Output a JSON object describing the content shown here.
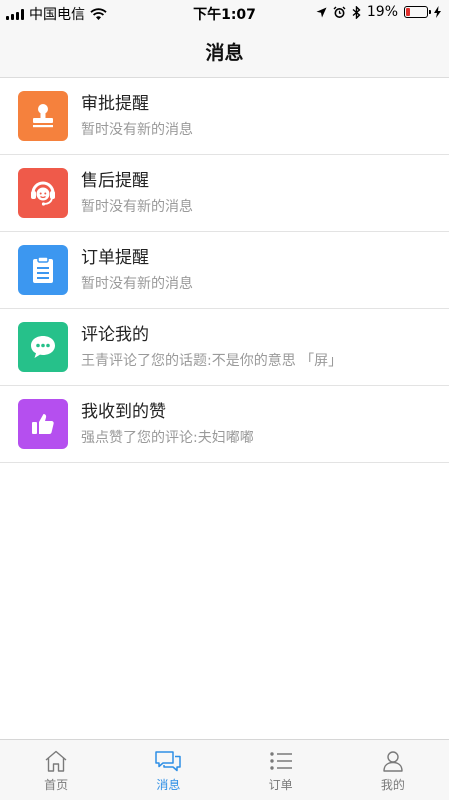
{
  "status_bar": {
    "carrier": "中国电信",
    "time": "下午1:07",
    "battery_percent": "19%",
    "battery_level": 0.19
  },
  "header": {
    "title": "消息"
  },
  "messages": [
    {
      "title": "审批提醒",
      "subtitle": "暂时没有新的消息",
      "color": "#f5813d",
      "icon": "stamp-icon"
    },
    {
      "title": "售后提醒",
      "subtitle": "暂时没有新的消息",
      "color": "#ef5a4a",
      "icon": "customer-service-icon"
    },
    {
      "title": "订单提醒",
      "subtitle": "暂时没有新的消息",
      "color": "#3c97f0",
      "icon": "clipboard-icon"
    },
    {
      "title": "评论我的",
      "subtitle": "王青评论了您的话题:不是你的意思 「屏」",
      "color": "#26c18a",
      "icon": "chat-bubble-icon"
    },
    {
      "title": "我收到的赞",
      "subtitle": "强点赞了您的评论:夫妇嘟嘟",
      "color": "#b54fef",
      "icon": "thumbs-up-icon"
    }
  ],
  "tabs": [
    {
      "label": "首页",
      "icon": "home-icon",
      "active": false
    },
    {
      "label": "消息",
      "icon": "messages-icon",
      "active": true
    },
    {
      "label": "订单",
      "icon": "list-icon",
      "active": false
    },
    {
      "label": "我的",
      "icon": "person-icon",
      "active": false
    }
  ],
  "colors": {
    "accent": "#2e8fe6",
    "inactive": "#7a7a7a"
  }
}
